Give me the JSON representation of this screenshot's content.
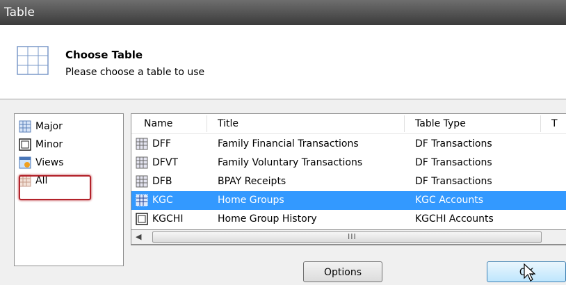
{
  "window": {
    "title": "Table"
  },
  "header": {
    "title": "Choose Table",
    "subtitle": "Please choose a table to use",
    "icon": "table-grid-icon"
  },
  "nav": {
    "items": [
      {
        "label": "Major",
        "icon": "major-table-icon"
      },
      {
        "label": "Minor",
        "icon": "minor-table-icon"
      },
      {
        "label": "Views",
        "icon": "views-icon"
      },
      {
        "label": "All",
        "icon": "all-tables-icon",
        "highlighted": true
      }
    ]
  },
  "list": {
    "columns": [
      "Name",
      "Title",
      "Table Type",
      "T"
    ],
    "rows": [
      {
        "name": "DFF",
        "title": "Family Financial Transactions",
        "type": "DF Transactions",
        "icon": "major-table-icon"
      },
      {
        "name": "DFVT",
        "title": "Family Voluntary Transactions",
        "type": "DF Transactions",
        "icon": "major-table-icon"
      },
      {
        "name": "DFB",
        "title": "BPAY Receipts",
        "type": "DF Transactions",
        "icon": "major-table-icon"
      },
      {
        "name": "KGC",
        "title": "Home Groups",
        "type": "KGC Accounts",
        "icon": "major-table-icon",
        "selected": true
      },
      {
        "name": "KGCHI",
        "title": "Home Group History",
        "type": "KGCHI Accounts",
        "icon": "minor-table-icon"
      }
    ],
    "scrollbar_grip": "III"
  },
  "buttons": {
    "options": "Options",
    "ok": "OK"
  },
  "colors": {
    "selection": "#3399ff",
    "highlight": "#b3222a",
    "titlebar": "#3b3b3b"
  }
}
